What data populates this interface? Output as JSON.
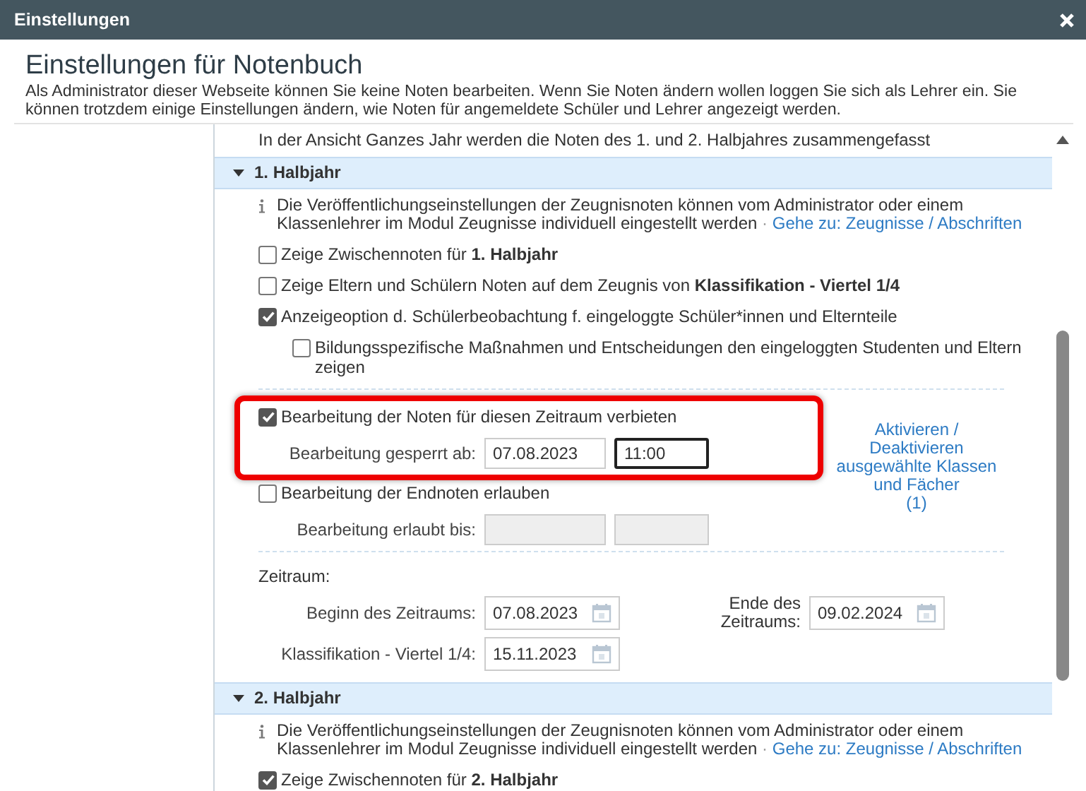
{
  "window": {
    "title": "Einstellungen"
  },
  "heading": "Einstellungen für Notenbuch",
  "description": "Als Administrator dieser Webseite können Sie keine Noten bearbeiten. Wenn Sie Noten ändern wollen loggen Sie sich als Lehrer ein. Sie können trotzdem einige Einstellungen ändern, wie Noten für angemeldete Schüler und Lehrer angezeigt werden.",
  "intro": "In der Ansicht Ganzes Jahr werden die Noten des 1. und 2. Halbjahres zusammengefasst",
  "sections": [
    {
      "title": "1. Halbjahr",
      "expanded": true,
      "info": "Die Veröffentlichungseinstellungen der Zeugnisnoten können vom Administrator oder einem Klassenlehrer im Modul Zeugnisse individuell eingestellt werden",
      "separator": "·",
      "info_link": "Gehe zu: Zeugnisse / Abschriften",
      "options": [
        {
          "label": "Zeige Zwischennoten für **1. Halbjahr**",
          "checked": false
        },
        {
          "label": "Zeige Eltern und Schülern Noten auf dem Zeugnis von **Klassifikation - Viertel 1/4**",
          "checked": false
        },
        {
          "label": "Anzeigeoption d. Schülerbeobachtung f. eingeloggte Schüler*innen und Elternteile",
          "checked": true,
          "children": [
            {
              "label": "Bildungsspezifische Maßnahmen und Entscheidungen den eingeloggten Studenten und Eltern zeigen",
              "checked": false
            }
          ]
        }
      ],
      "lock": {
        "label": "Bearbeitung der Noten für diesen Zeitraum verbieten",
        "checked": true,
        "highlighted": true,
        "field_label": "Bearbeitung gesperrt ab:",
        "date": "07.08.2023",
        "time": "11:00"
      },
      "final_grades": {
        "label": "Bearbeitung der Endnoten erlauben",
        "checked": false,
        "disabled": true,
        "field_label": "Bearbeitung erlaubt bis:"
      },
      "toggle_link": {
        "text": "Aktivieren / Deaktivieren ausgewählte Klassen und Fächer",
        "count": "(1)"
      },
      "period": {
        "label": "Zeitraum:",
        "start_label": "Beginn des Zeitraums:",
        "start": "07.08.2023",
        "end_label": "Ende des Zeitraums:",
        "end": "09.02.2024",
        "quarter_label": "Klassifikation - Viertel 1/4:",
        "quarter": "15.11.2023"
      }
    },
    {
      "title": "2. Halbjahr",
      "expanded": true,
      "info": "Die Veröffentlichungseinstellungen der Zeugnisnoten können vom Administrator oder einem Klassenlehrer im Modul Zeugnisse individuell eingestellt werden",
      "separator": "·",
      "info_link": "Gehe zu: Zeugnisse / Abschriften",
      "options": [
        {
          "label": "Zeige Zwischennoten für **2. Halbjahr**",
          "checked": true
        }
      ]
    }
  ]
}
